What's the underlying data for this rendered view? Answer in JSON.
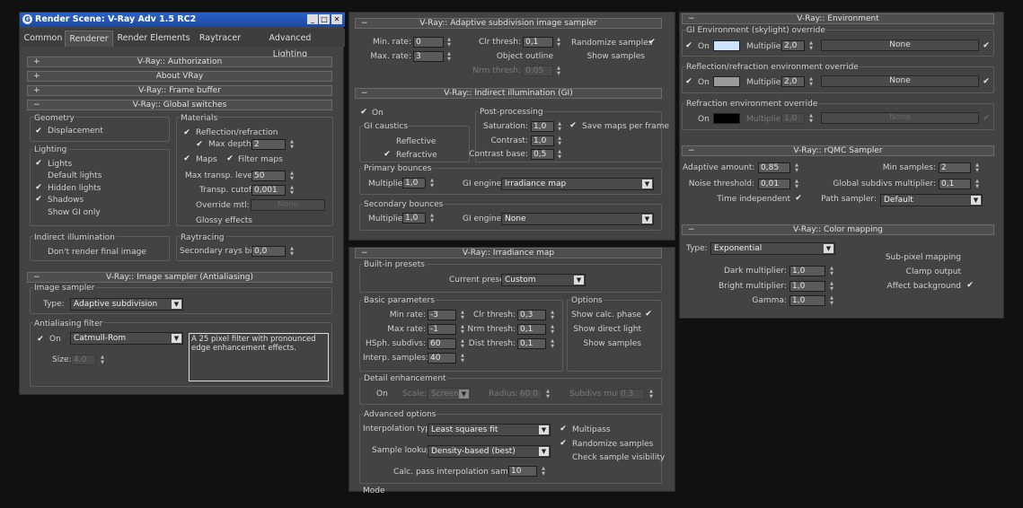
{
  "window": {
    "title": "Render Scene: V-Ray Adv 1.5 RC2"
  },
  "tabs": [
    "Common",
    "Renderer",
    "Render Elements",
    "Raytracer",
    "Advanced Lighting"
  ],
  "left": {
    "authorization": "V-Ray:: Authorization",
    "about": "About VRay",
    "framebuffer": "V-Ray:: Frame buffer",
    "global": "V-Ray:: Global switches",
    "geometry": "Geometry",
    "displacement": "Displacement",
    "materials": "Materials",
    "reflection_refraction": "Reflection/refraction",
    "max_depth": "Max depth",
    "max_depth_val": "2",
    "maps": "Maps",
    "filter_maps": "Filter maps",
    "max_transp": "Max transp. levels",
    "max_transp_val": "50",
    "transp_cutoff": "Transp. cutoff",
    "transp_cutoff_val": "0,001",
    "override_mtl": "Override mtl:",
    "none": "None",
    "glossy": "Glossy effects",
    "lighting": "Lighting",
    "lights": "Lights",
    "default_lights": "Default lights",
    "hidden_lights": "Hidden lights",
    "shadows": "Shadows",
    "show_gi_only": "Show GI only",
    "indirect": "Indirect illumination",
    "dont_render": "Don't render final image",
    "raytracing": "Raytracing",
    "sec_rays": "Secondary rays bias",
    "sec_rays_val": "0,0",
    "image_sampler_hdr": "V-Ray:: Image sampler (Antialiasing)",
    "image_sampler": "Image sampler",
    "type": "Type:",
    "type_val": "Adaptive subdivision",
    "aa_filter": "Antialiasing filter",
    "on": "On",
    "filter_val": "Catmull-Rom",
    "size": "Size:",
    "size_val": "4,0",
    "filter_desc": "A 25 pixel filter with pronounced edge enhancement effects."
  },
  "mid_top": {
    "adaptive_hdr": "V-Ray:: Adaptive subdivision image sampler",
    "min_rate": "Min. rate:",
    "min_rate_val": "0",
    "max_rate": "Max. rate:",
    "max_rate_val": "3",
    "clr_thresh": "Clr thresh:",
    "clr_thresh_val": "0,1",
    "object_outline": "Object outline",
    "nrm_thresh": "Nrm thresh:",
    "nrm_thresh_val": "0,05",
    "randomize": "Randomize samples",
    "show_samples": "Show samples",
    "gi_hdr": "V-Ray:: Indirect illumination (GI)",
    "on": "On",
    "gi_caustics": "GI caustics",
    "reflective": "Reflective",
    "refractive": "Refractive",
    "post": "Post-processing",
    "saturation": "Saturation:",
    "saturation_val": "1,0",
    "save_maps": "Save maps per frame",
    "contrast": "Contrast:",
    "contrast_val": "1,0",
    "contrast_base": "Contrast base:",
    "contrast_base_val": "0,5",
    "primary": "Primary bounces",
    "multiplier": "Multiplier:",
    "primary_mult": "1,0",
    "gi_engine": "GI engine:",
    "primary_engine": "Irradiance map",
    "secondary": "Secondary bounces",
    "secondary_mult": "1,0",
    "secondary_engine": "None"
  },
  "mid_bot": {
    "irr_hdr": "V-Ray:: Irradiance map",
    "builtin": "Built-in presets",
    "current_preset": "Current preset:",
    "preset_val": "Custom",
    "basic": "Basic parameters",
    "min_rate": "Min rate:",
    "min_rate_val": "-3",
    "max_rate": "Max rate:",
    "max_rate_val": "-1",
    "hsph": "HSph. subdivs:",
    "hsph_val": "60",
    "interp": "Interp. samples:",
    "interp_val": "40",
    "clr_thresh": "Clr thresh:",
    "clr_val": "0,3",
    "nrm_thresh": "Nrm thresh:",
    "nrm_val": "0,1",
    "dist_thresh": "Dist thresh:",
    "dist_val": "0,1",
    "options": "Options",
    "show_calc": "Show calc. phase",
    "show_direct": "Show direct light",
    "show_samples": "Show samples",
    "detail": "Detail enhancement",
    "on": "On",
    "scale": "Scale:",
    "scale_val": "Screen",
    "radius": "Radius:",
    "radius_val": "60,0",
    "subdivs_mult": "Subdivs mult.",
    "subdivs_mult_val": "0,3",
    "advanced": "Advanced options",
    "interp_type": "Interpolation type:",
    "interp_type_val": "Least squares fit (good/smooth",
    "multipass": "Multipass",
    "randomize": "Randomize samples",
    "sample_lookup": "Sample lookup:",
    "sample_lookup_val": "Density-based (best)",
    "check_vis": "Check sample visibility",
    "calc_pass": "Calc. pass interpolation samples:",
    "calc_pass_val": "10",
    "mode": "Mode"
  },
  "right": {
    "env_hdr": "V-Ray:: Environment",
    "gi_env": "GI Environment (skylight) override",
    "on": "On",
    "multiplier": "Multiplier:",
    "gi_mult": "2,0",
    "none": "None",
    "refl_env": "Reflection/refraction environment override",
    "refl_mult": "2,0",
    "refr_env": "Refraction environment override",
    "refr_mult": "1,0",
    "rqmc_hdr": "V-Ray:: rQMC Sampler",
    "adaptive_amount": "Adaptive amount:",
    "adaptive_val": "0,85",
    "min_samples": "Min samples:",
    "min_samples_val": "2",
    "noise": "Noise threshold:",
    "noise_val": "0,01",
    "global_subdivs": "Global subdivs multiplier:",
    "global_subdivs_val": "0,1",
    "time_indep": "Time independent",
    "path_sampler": "Path sampler:",
    "path_sampler_val": "Default",
    "color_hdr": "V-Ray:: Color mapping",
    "type": "Type:",
    "type_val": "Exponential",
    "dark": "Dark multiplier:",
    "dark_val": "1,0",
    "bright": "Bright multiplier:",
    "bright_val": "1,0",
    "gamma": "Gamma:",
    "gamma_val": "1,0",
    "subpixel": "Sub-pixel mapping",
    "clamp": "Clamp output",
    "affect_bg": "Affect background"
  },
  "colors": {
    "accent_title": "#1c57b9",
    "swatch_light": "#cfe3ff",
    "swatch_gray": "#9a9a9a",
    "swatch_black": "#000000"
  }
}
